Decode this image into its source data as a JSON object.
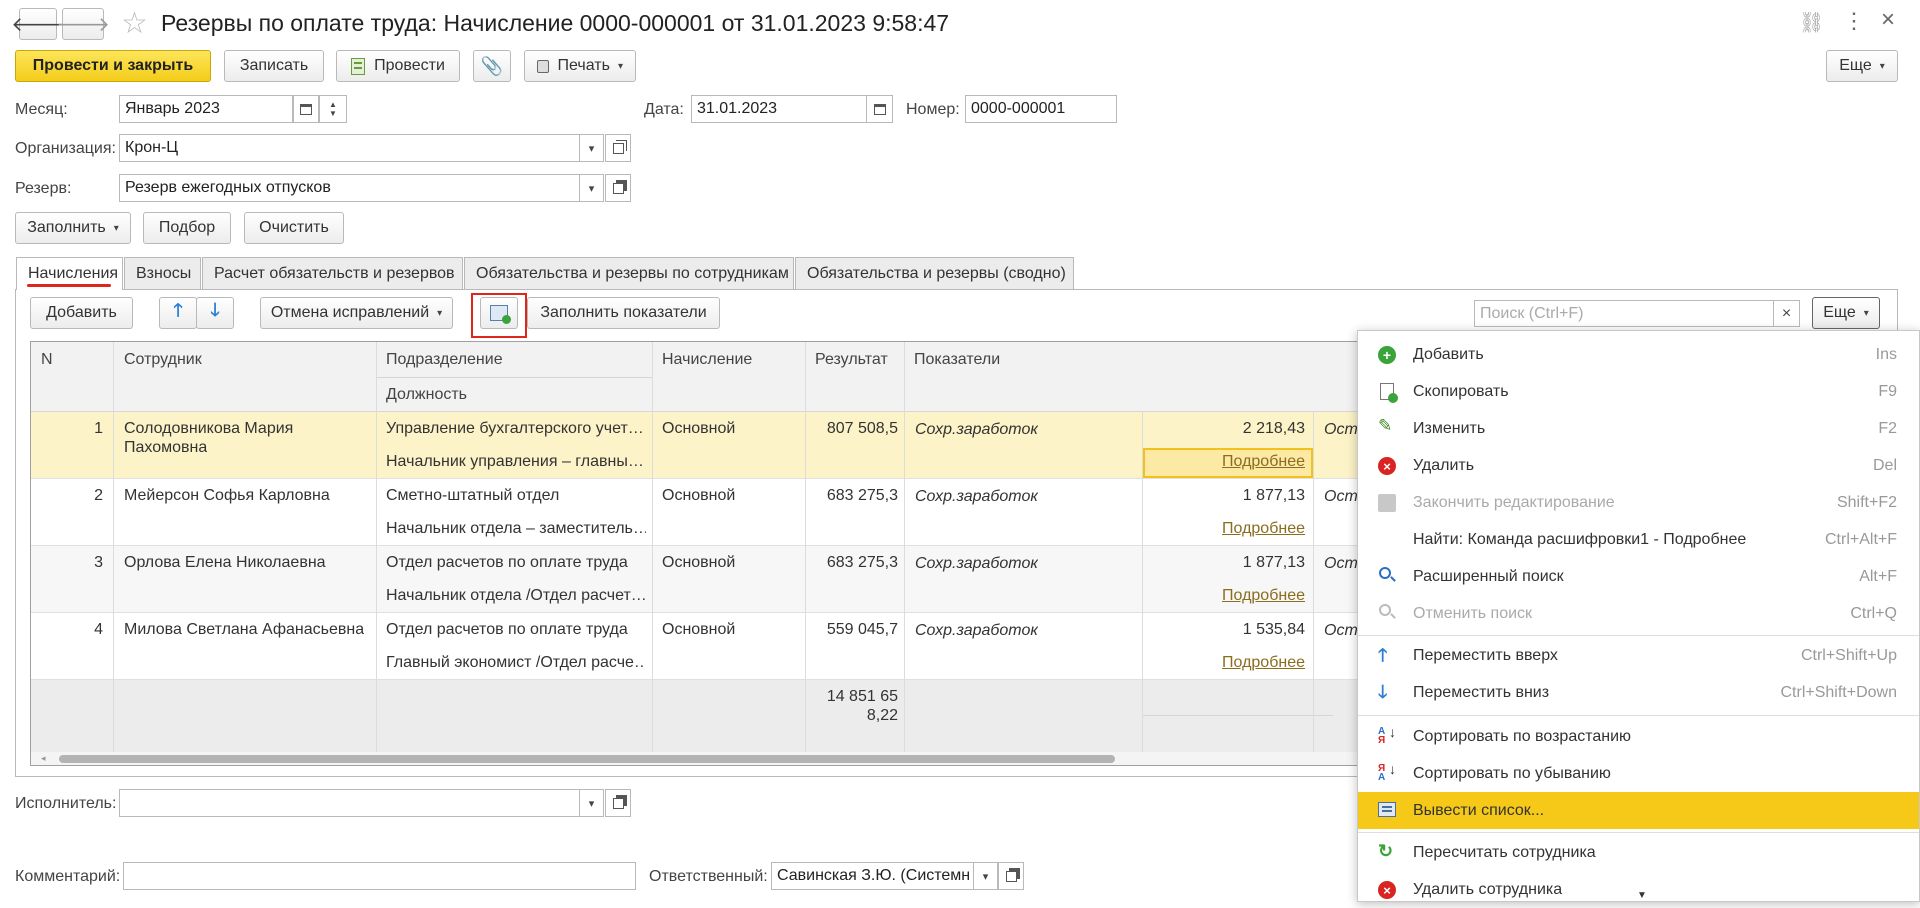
{
  "window": {
    "title": "Резервы по оплате труда: Начисление 0000-000001 от 31.01.2023 9:58:47"
  },
  "toolbar": {
    "post_close": "Провести и закрыть",
    "save": "Записать",
    "post": "Провести",
    "print": "Печать",
    "more": "Еще"
  },
  "header": {
    "month_label": "Месяц:",
    "month_value": "Январь 2023",
    "date_label": "Дата:",
    "date_value": "31.01.2023",
    "number_label": "Номер:",
    "number_value": "0000-000001",
    "org_label": "Организация:",
    "org_value": "Крон-Ц",
    "reserve_label": "Резерв:",
    "reserve_value": "Резерв ежегодных отпусков"
  },
  "actions": {
    "fill": "Заполнить",
    "pick": "Подбор",
    "clear": "Очистить"
  },
  "tabs": [
    {
      "label": "Начисления"
    },
    {
      "label": "Взносы"
    },
    {
      "label": "Расчет обязательств и резервов"
    },
    {
      "label": "Обязательства и резервы по сотрудникам"
    },
    {
      "label": "Обязательства и резервы (сводно)"
    }
  ],
  "table_toolbar": {
    "add": "Добавить",
    "cancel_corrections": "Отмена исправлений",
    "fill_indicators": "Заполнить показатели",
    "search_placeholder": "Поиск (Ctrl+F)",
    "more": "Еще"
  },
  "table": {
    "columns": {
      "n": "N",
      "employee": "Сотрудник",
      "department": "Подразделение",
      "position": "Должность",
      "accrual": "Начисление",
      "result": "Результат",
      "indicators": "Показатели"
    },
    "rows": [
      {
        "n": "1",
        "employee": "Солодовникова Мария",
        "employee2": "Пахомовна",
        "department": "Управление бухгалтерского учет…",
        "position": "Начальник управления – главны…",
        "accrual": "Основной",
        "result": "807 508,5",
        "indicator": "Сохр.заработок",
        "ind_value": "2 218,43",
        "details": "Подробнее",
        "extra": "Ост"
      },
      {
        "n": "2",
        "employee": "Мейерсон Софья Карловна",
        "employee2": "",
        "department": "Сметно-штатный отдел",
        "position": "Начальник отдела – заместитель…",
        "accrual": "Основной",
        "result": "683 275,3",
        "indicator": "Сохр.заработок",
        "ind_value": "1 877,13",
        "details": "Подробнее",
        "extra": "Ост"
      },
      {
        "n": "3",
        "employee": "Орлова Елена Николаевна",
        "employee2": "",
        "department": "Отдел расчетов по оплате труда",
        "position": "Начальник отдела /Отдел расчет…",
        "accrual": "Основной",
        "result": "683 275,3",
        "indicator": "Сохр.заработок",
        "ind_value": "1 877,13",
        "details": "Подробнее",
        "extra": "Ост"
      },
      {
        "n": "4",
        "employee": "Милова Светлана Афанасьевна",
        "employee2": "",
        "department": "Отдел расчетов по оплате труда",
        "position": "Главный экономист /Отдел расче…",
        "accrual": "Основной",
        "result": "559 045,7",
        "indicator": "Сохр.заработок",
        "ind_value": "1 535,84",
        "details": "Подробнее",
        "extra": "Ост"
      }
    ],
    "total_line1": "14 851 65",
    "total_line2": "8,22"
  },
  "footer": {
    "executor_label": "Исполнитель:",
    "executor_value": "",
    "comment_label": "Комментарий:",
    "comment_value": "",
    "responsible_label": "Ответственный:",
    "responsible_value": "Савинская З.Ю. (Системн"
  },
  "context_menu": {
    "items": [
      {
        "label": "Добавить",
        "key": "Ins",
        "icon": "add-icon"
      },
      {
        "label": "Скопировать",
        "key": "F9",
        "icon": "copy-icon"
      },
      {
        "label": "Изменить",
        "key": "F2",
        "icon": "edit-icon"
      },
      {
        "label": "Удалить",
        "key": "Del",
        "icon": "delete-icon"
      },
      {
        "label": "Закончить редактирование",
        "key": "Shift+F2",
        "icon": "end-edit-icon"
      },
      {
        "label": "Найти: Команда расшифровки1 - Подробнее",
        "key": "Ctrl+Alt+F",
        "icon": ""
      },
      {
        "label": "Расширенный поиск",
        "key": "Alt+F",
        "icon": "search-icon"
      },
      {
        "label": "Отменить поиск",
        "key": "Ctrl+Q",
        "icon": "cancel-search-icon"
      },
      {
        "label": "Переместить вверх",
        "key": "Ctrl+Shift+Up",
        "icon": "arrow-up-icon"
      },
      {
        "label": "Переместить вниз",
        "key": "Ctrl+Shift+Down",
        "icon": "arrow-down-icon"
      },
      {
        "label": "Сортировать по возрастанию",
        "key": "",
        "icon": "sort-asc-icon"
      },
      {
        "label": "Сортировать по убыванию",
        "key": "",
        "icon": "sort-desc-icon"
      },
      {
        "label": "Вывести список...",
        "key": "",
        "icon": "list-output-icon"
      },
      {
        "label": "Пересчитать сотрудника",
        "key": "",
        "icon": "refresh-icon"
      },
      {
        "label": "Удалить сотрудника",
        "key": "",
        "icon": "delete-employee-icon"
      }
    ]
  },
  "colors": {
    "accent_yellow": "#f6c919",
    "row_highlight": "#fdf3c8",
    "link": "#8a6d1e",
    "highlight_box": "#e0251b"
  }
}
